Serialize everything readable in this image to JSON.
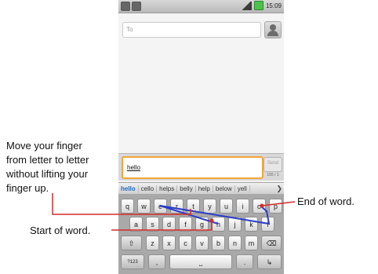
{
  "status_bar": {
    "time": "15:09"
  },
  "to_field": {
    "placeholder": "To"
  },
  "compose": {
    "text": "hello",
    "send_label": "Send",
    "counter": "155 / 1"
  },
  "suggestions": [
    "hello",
    "cello",
    "helps",
    "belly",
    "help",
    "below",
    "yell"
  ],
  "keyboard": {
    "row1": [
      "q",
      "w",
      "e",
      "r",
      "t",
      "y",
      "u",
      "i",
      "o",
      "p"
    ],
    "row2": [
      "a",
      "s",
      "d",
      "f",
      "g",
      "h",
      "j",
      "k",
      "l"
    ],
    "row3": [
      "z",
      "x",
      "c",
      "v",
      "b",
      "n",
      "m"
    ],
    "numbers_label": "?123",
    "comma_label": ",",
    "period_label": "."
  },
  "annotations": {
    "instruction": [
      "Move your finger",
      "from letter to letter",
      "without lifting your",
      "finger up."
    ],
    "end_label": "End of word.",
    "start_label": "Start of word."
  },
  "colors": {
    "accent": "#f2a53a",
    "suggestion_highlight": "#1f6cc4",
    "path_line": "#2b3dc9",
    "annotation_line": "#d62b2b"
  }
}
